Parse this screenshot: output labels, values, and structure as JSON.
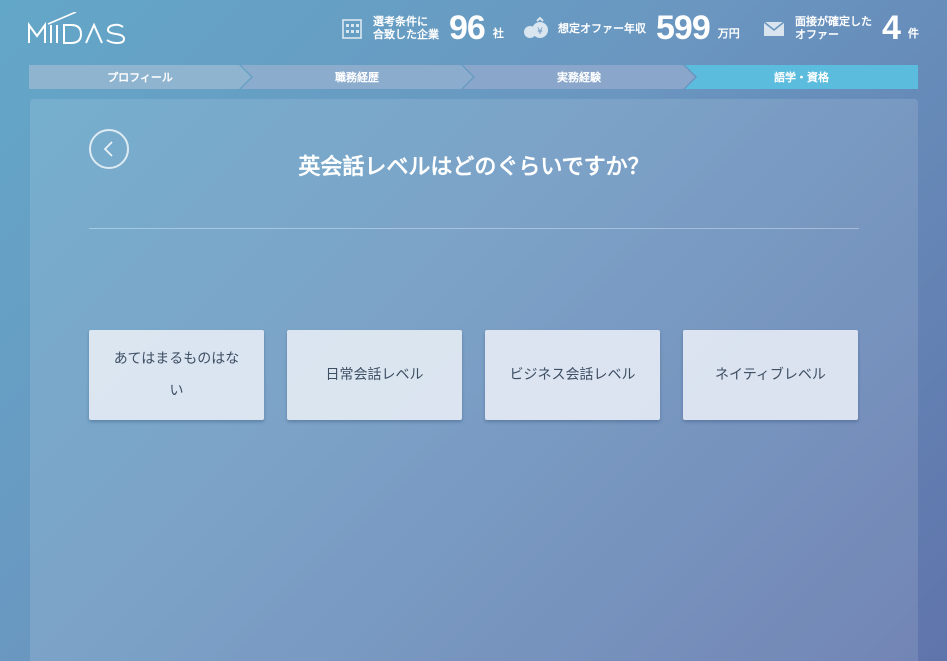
{
  "header": {
    "logo_text": "MIIDAS",
    "stats": [
      {
        "icon": "building-icon",
        "label": "選考条件に\n合致した企業",
        "value": "96",
        "unit": "社"
      },
      {
        "icon": "money-bag-icon",
        "label": "想定オファー年収",
        "value": "599",
        "unit": "万円"
      },
      {
        "icon": "envelope-icon",
        "label": "面接が確定した\nオファー",
        "value": "4",
        "unit": "件"
      }
    ]
  },
  "steps": [
    {
      "label": "プロフィール",
      "active": false
    },
    {
      "label": "職務経歴",
      "active": false
    },
    {
      "label": "実務経験",
      "active": false
    },
    {
      "label": "語学・資格",
      "active": true
    }
  ],
  "colors": {
    "step_inactive": "#8fb4d0",
    "step_active": "#5bbcde"
  },
  "question": {
    "title": "英会話レベルはどのぐらいですか？",
    "options": [
      "あてはまるものはない",
      "日常会話レベル",
      "ビジネス会話レベル",
      "ネイティブレベル"
    ]
  }
}
